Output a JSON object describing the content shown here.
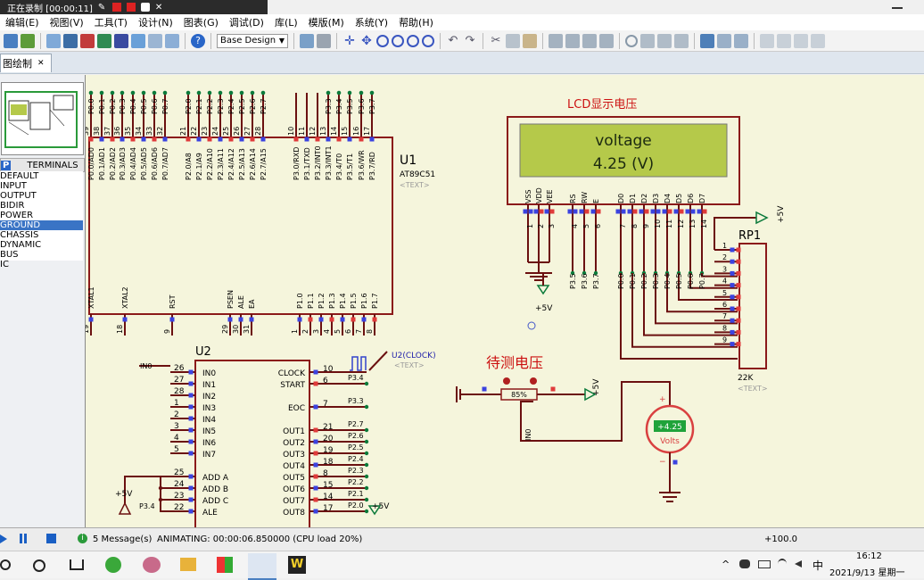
{
  "recording": {
    "status": "正在录制 [00:00:11]"
  },
  "menu": [
    "编辑(E)",
    "视图(V)",
    "工具(T)",
    "设计(N)",
    "图表(G)",
    "调试(D)",
    "库(L)",
    "模版(M)",
    "系统(Y)",
    "帮助(H)"
  ],
  "toolbar": {
    "layer": "Base Design"
  },
  "tab": {
    "label": "图绘制",
    "close": "✕"
  },
  "terminals": {
    "header_icon": "P",
    "header": "TERMINALS",
    "items": [
      "DEFAULT",
      "INPUT",
      "OUTPUT",
      "BIDIR",
      "POWER",
      "GROUND",
      "CHASSIS",
      "DYNAMIC",
      "BUS",
      "IC"
    ],
    "selected_index": 5
  },
  "schematic": {
    "lcd_title": "LCD显示电压",
    "lcd_line1": "voltage",
    "lcd_line2": "4.25 (V)",
    "lcd_pins": [
      "VSS",
      "VDD",
      "VEE",
      "RS",
      "RW",
      "E",
      "D0",
      "D1",
      "D2",
      "D3",
      "D4",
      "D5",
      "D6",
      "D7"
    ],
    "lcd_pin_nums": [
      "1",
      "2",
      "3",
      "4",
      "5",
      "6",
      "7",
      "8",
      "9",
      "10",
      "11",
      "12",
      "13",
      "14"
    ],
    "lcd_net_labels": [
      "P3.5",
      "P3.6",
      "P3.7",
      "P0.0",
      "P0.1",
      "P0.2",
      "P0.3",
      "P0.4",
      "P0.5",
      "P0.6",
      "P0.7"
    ],
    "lcd_supply": "+5V",
    "u1_ref": "U1",
    "u1_part": "AT89C51",
    "u1_text": "<TEXT>",
    "u1_top_pins": [
      "P0.0/AD0",
      "P0.1/AD1",
      "P0.2/AD2",
      "P0.3/AD3",
      "P0.4/AD4",
      "P0.5/AD5",
      "P0.6/AD6",
      "P0.7/AD7",
      "P2.0/A8",
      "P2.1/A9",
      "P2.2/A10",
      "P2.3/A11",
      "P2.4/A12",
      "P2.5/A13",
      "P2.6/A14",
      "P2.7/A15",
      "P3.0/RXD",
      "P3.1/TXD",
      "P3.2/INT0",
      "P3.3/INT1",
      "P3.4/T0",
      "P3.5/T1",
      "P3.6/WR",
      "P3.7/RD"
    ],
    "u1_top_nums": [
      "39",
      "38",
      "37",
      "36",
      "35",
      "34",
      "33",
      "32",
      "21",
      "22",
      "23",
      "24",
      "25",
      "26",
      "27",
      "28",
      "10",
      "11",
      "12",
      "13",
      "14",
      "15",
      "16",
      "17"
    ],
    "u1_top_nets": [
      "P0.0",
      "P0.1",
      "P0.2",
      "P0.3",
      "P0.4",
      "P0.5",
      "P0.6",
      "P0.7",
      "P2.0",
      "P2.1",
      "P2.2",
      "P2.3",
      "P2.4",
      "P2.5",
      "P2.6",
      "P2.7",
      "P3.3",
      "P3.4",
      "P3.5",
      "P3.6",
      "P3.7"
    ],
    "u1_bottom_left": [
      "XTAL1",
      "XTAL2",
      "RST",
      "PSEN",
      "ALE",
      "EA"
    ],
    "u1_bottom_left_nums": [
      "19",
      "18",
      "9",
      "29",
      "30",
      "31"
    ],
    "u1_bottom_right": [
      "P1.0",
      "P1.1",
      "P1.2",
      "P1.3",
      "P1.4",
      "P1.5",
      "P1.6",
      "P1.7"
    ],
    "u1_bottom_right_nums": [
      "1",
      "2",
      "3",
      "4",
      "5",
      "6",
      "7",
      "8"
    ],
    "u2_ref": "U2",
    "u2_left_pins": [
      "IN0",
      "IN1",
      "IN2",
      "IN3",
      "IN4",
      "IN5",
      "IN6",
      "IN7",
      "ADD A",
      "ADD B",
      "ADD C",
      "ALE"
    ],
    "u2_left_nums": [
      "26",
      "27",
      "28",
      "1",
      "2",
      "3",
      "4",
      "5",
      "25",
      "24",
      "23",
      "22"
    ],
    "u2_right_pins": [
      "CLOCK",
      "START",
      "EOC",
      "OUT1",
      "OUT2",
      "OUT3",
      "OUT4",
      "OUT5",
      "OUT6",
      "OUT7",
      "OUT8"
    ],
    "u2_right_nums": [
      "10",
      "6",
      "7",
      "21",
      "20",
      "19",
      "18",
      "8",
      "15",
      "14",
      "17"
    ],
    "u2_right_nets": [
      "",
      "P3.4",
      "P3.3",
      "P2.7",
      "P2.6",
      "P2.5",
      "P2.4",
      "P2.3",
      "P2.2",
      "P2.1",
      "P2.0"
    ],
    "u2_in0_net": "IN0",
    "u2_clock": "U2(CLOCK)",
    "u2_clock_text": "<TEXT>",
    "u2_supply": "+5V",
    "u2_ale_net": "P3.4",
    "u2_out_supply": "+5V",
    "pot_title": "待测电压",
    "pot_percent": "85%",
    "pot_supply": "+5V",
    "pot_net": "IN0",
    "voltmeter_value": "+4.25",
    "voltmeter_unit": "Volts",
    "voltmeter_plus": "+",
    "voltmeter_minus": "−",
    "rp1_ref": "RP1",
    "rp1_value": "22K",
    "rp1_text": "<TEXT>",
    "rp1_pins": [
      "1",
      "2",
      "3",
      "4",
      "5",
      "6",
      "7",
      "8",
      "9"
    ],
    "rp1_supply": "+5V"
  },
  "status": {
    "messages": "5 Message(s)",
    "animating": "ANIMATING: 00:00:06.850000 (CPU load 20%)",
    "coord": "+100.0"
  },
  "taskbar": {
    "ime": "中",
    "time": "16:12",
    "date": "2021/9/13 星期一"
  },
  "colors": {
    "canvas_bg": "#f5f5dc",
    "component": "#8b1a1a",
    "wire": "#6b1010",
    "lcd_screen": "#b5c94a",
    "lcd_text": "#1c2a10",
    "title_red": "#cc1111",
    "pin_blue": "#3b43e0",
    "pin_red": "#e03b3b",
    "terminal_green": "#0a7a3a",
    "label_blue": "#2222aa",
    "voltmeter_body": "#d94040",
    "voltmeter_lcd": "#1fa33a"
  }
}
